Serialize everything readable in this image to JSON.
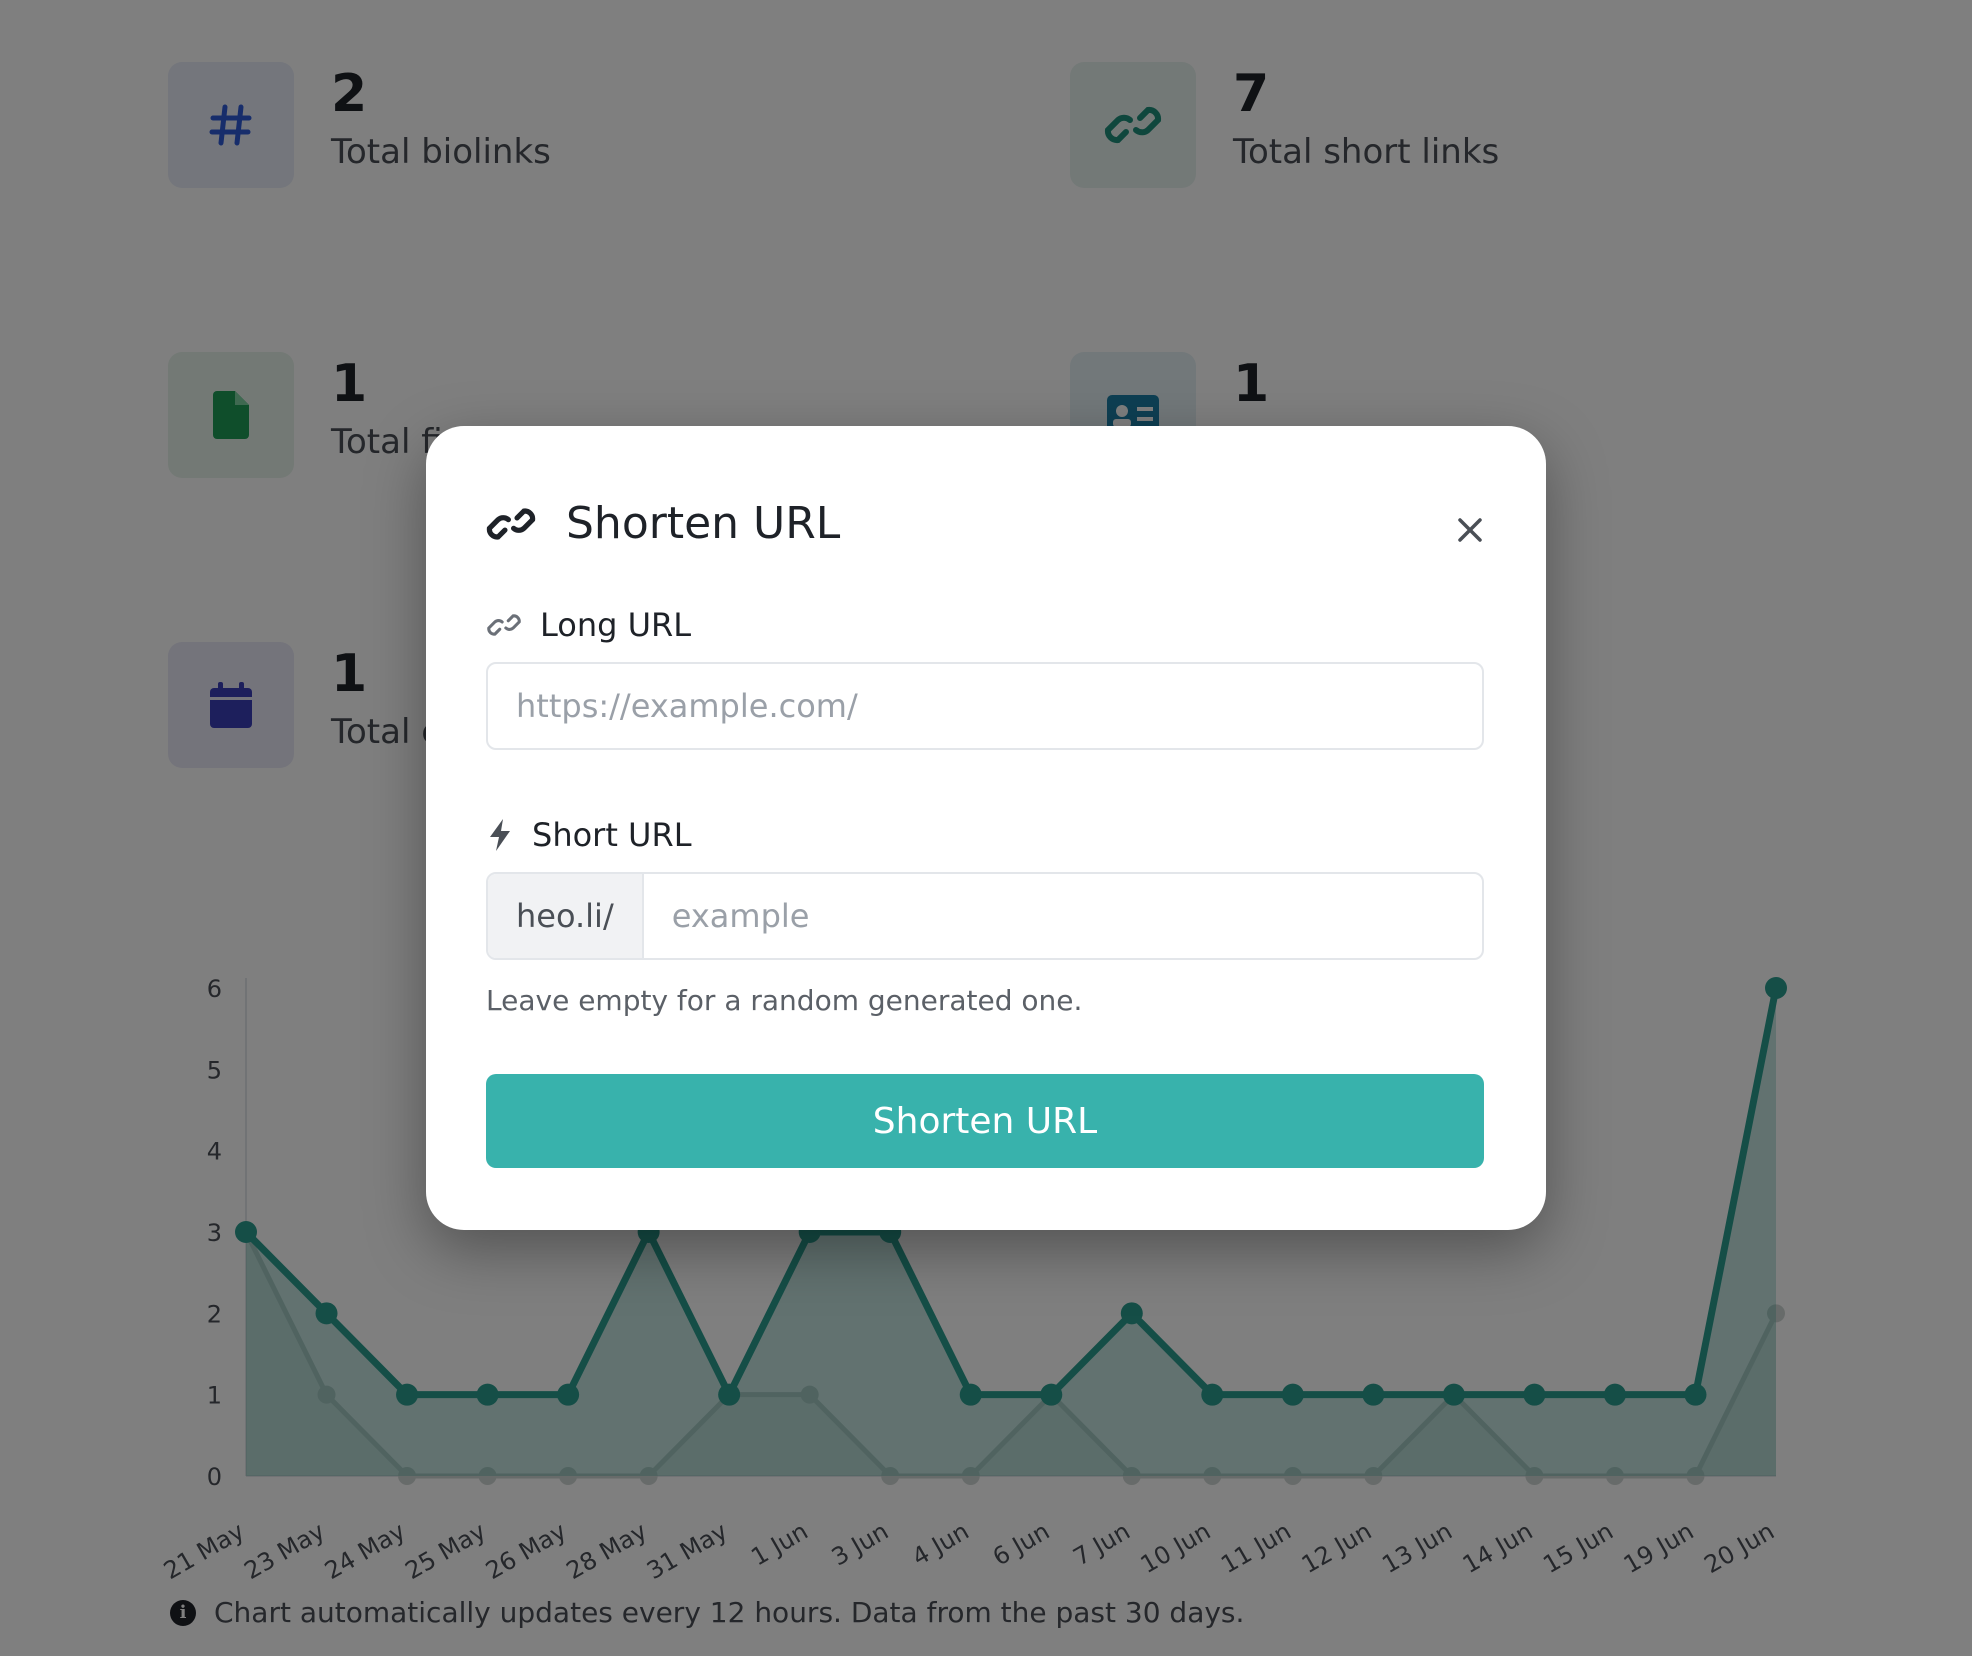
{
  "stats": [
    {
      "value": "2",
      "label": "Total biolinks",
      "icon": "hash-icon",
      "icon_color": "#2f5bd6",
      "bg": "#e8edf8"
    },
    {
      "value": "7",
      "label": "Total short links",
      "icon": "link-icon",
      "icon_color": "#1f8f7a",
      "bg": "#e7f2ef"
    },
    {
      "value": "1",
      "label": "Total fi",
      "icon": "file-icon",
      "icon_color": "#1f9d57",
      "bg": "#e6f3ea"
    },
    {
      "value": "1",
      "label": "",
      "icon": "vcard-icon",
      "icon_color": "#1d7fa6",
      "bg": "#e5f0f5"
    },
    {
      "value": "1",
      "label": "Total e",
      "icon": "calendar-icon",
      "icon_color": "#3b3fb8",
      "bg": "#e9e9f7"
    }
  ],
  "chart_data": {
    "type": "line",
    "categories": [
      "21 May",
      "23 May",
      "24 May",
      "25 May",
      "26 May",
      "28 May",
      "31 May",
      "1 Jun",
      "3 Jun",
      "4 Jun",
      "6 Jun",
      "7 Jun",
      "10 Jun",
      "11 Jun",
      "12 Jun",
      "13 Jun",
      "14 Jun",
      "15 Jun",
      "19 Jun",
      "20 Jun"
    ],
    "series": [
      {
        "values": [
          3,
          2,
          1,
          1,
          1,
          3,
          1,
          3,
          3,
          1,
          1,
          2,
          1,
          1,
          1,
          1,
          1,
          1,
          1,
          6
        ],
        "color": "#2a9d8f"
      },
      {
        "values": [
          3,
          1,
          0,
          0,
          0,
          0,
          1,
          1,
          0,
          0,
          1,
          0,
          0,
          0,
          0,
          1,
          0,
          0,
          0,
          2
        ],
        "color": "#cfd6d4"
      }
    ],
    "ylim": [
      0,
      6
    ],
    "yticks": [
      "0",
      "1",
      "2",
      "3",
      "4",
      "5",
      "6"
    ],
    "grid": false
  },
  "chart_note": "Chart automatically updates every 12 hours. Data from the past 30 days.",
  "modal": {
    "title": "Shorten URL",
    "long_url_label": "Long URL",
    "long_url_placeholder": "https://example.com/",
    "long_url_value": "",
    "short_url_label": "Short URL",
    "short_url_prefix": "heo.li/",
    "short_url_placeholder": "example",
    "short_url_value": "",
    "help_text": "Leave empty for a random generated one.",
    "submit_label": "Shorten URL",
    "accent": "#38b2ac"
  }
}
